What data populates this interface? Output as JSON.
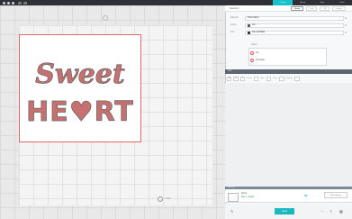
{
  "colors": {
    "titlebar": "#2f3136",
    "accent": "#18c2c8",
    "cut_line": "#e06a6a",
    "design_fill": "#c7706f",
    "design_outline": "#6a6a6a"
  },
  "topnav": {
    "tabs": [
      {
        "label": "Canvas",
        "active": true
      },
      {
        "label": "Library",
        "active": false
      },
      {
        "label": "Store",
        "active": false
      },
      {
        "label": "Send",
        "active": false
      }
    ]
  },
  "canvas": {
    "design_text_line1": "Sweet",
    "design_text_line2": "HE♥RT",
    "zoom_label": "100%"
  },
  "panel": {
    "title": "Selection",
    "tabs": [
      {
        "label": "Shape",
        "active": true
      },
      {
        "label": "Line",
        "active": false
      },
      {
        "label": "Fill",
        "active": false
      },
      {
        "label": "Layers",
        "active": false
      }
    ],
    "properties": [
      {
        "label": "Material",
        "value": "Vinyl Glossy",
        "swatch": ""
      },
      {
        "label": "Action",
        "value": "Cut",
        "swatch": "#555555"
      },
      {
        "label": "Tool",
        "value": "Fine-tip Blade",
        "swatch": "#333333"
      }
    ],
    "sub_header": "Attach",
    "layers": [
      {
        "label": "Cut"
      },
      {
        "label": "Cut Outer"
      }
    ]
  },
  "text_toolbar": {
    "label": "Text",
    "items": [
      "A",
      "B",
      "I",
      "Leave",
      "Size",
      "Kern",
      "Thrash"
    ]
  },
  "mat_section": {
    "strip_label": "Mats (1)",
    "line1": "Cricut",
    "line2": "Mat 1 • Ready",
    "button": "Mat settings"
  },
  "footer": {
    "send_label": "Send",
    "icons": [
      "pencil-icon",
      "dots-icon",
      "share-icon",
      "grid-icon"
    ]
  }
}
